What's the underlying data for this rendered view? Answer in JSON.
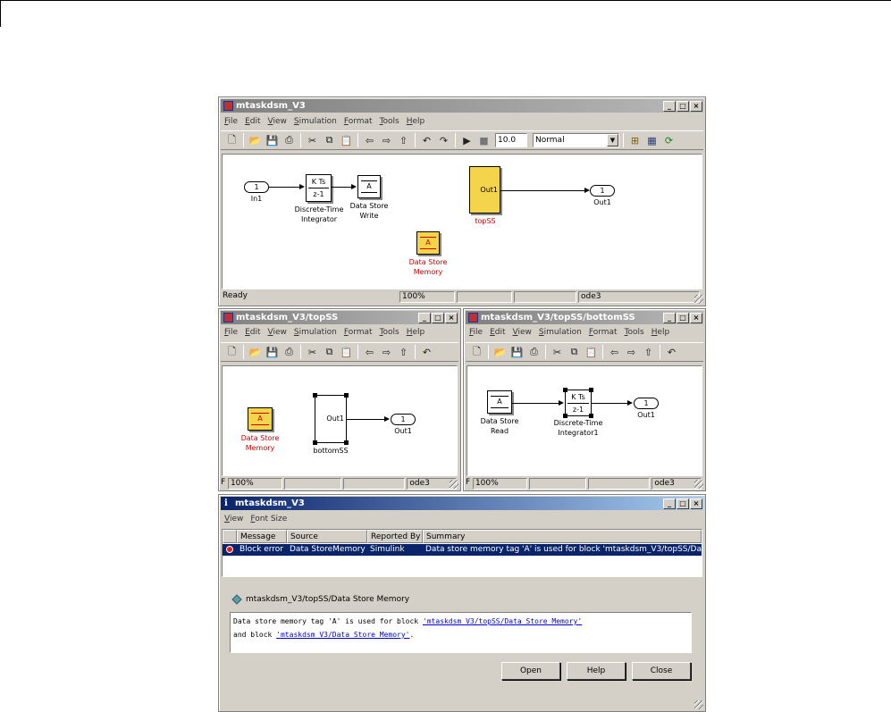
{
  "main_window": {
    "title": "mtaskdsm_V3",
    "menu": [
      "File",
      "Edit",
      "View",
      "Simulation",
      "Format",
      "Tools",
      "Help"
    ],
    "stop_time": "10.0",
    "sim_mode": "Normal",
    "blocks": {
      "in1_port": "1",
      "in1_label": "In1",
      "integrator_top": "K Ts",
      "integrator_bottom": "z-1",
      "integrator_label": "Discrete-Time\nIntegrator",
      "dsw_text": "A",
      "dsw_label": "Data Store\nWrite",
      "topss_port": "Out1",
      "topss_label": "topSS",
      "out1_port": "1",
      "out1_label": "Out1",
      "dsm_text": "A",
      "dsm_label": "Data Store\nMemory"
    },
    "status": {
      "state": "Ready",
      "zoom": "100%",
      "solver": "ode3"
    }
  },
  "topss_window": {
    "title": "mtaskdsm_V3/topSS",
    "menu": [
      "File",
      "Edit",
      "View",
      "Simulation",
      "Format",
      "Tools",
      "Help"
    ],
    "blocks": {
      "dsm_text": "A",
      "dsm_label": "Data Store\nMemory",
      "bottomss_port": "Out1",
      "bottomss_label": "bottomSS",
      "out1_port": "1",
      "out1_label": "Out1"
    },
    "status": {
      "state": "F",
      "zoom": "100%",
      "solver": "ode3"
    }
  },
  "bottomss_window": {
    "title": "mtaskdsm_V3/topSS/bottomSS",
    "menu": [
      "File",
      "Edit",
      "View",
      "Simulation",
      "Format",
      "Tools",
      "Help"
    ],
    "blocks": {
      "dsr_text": "A",
      "dsr_label": "Data Store\nRead",
      "integrator_top": "K Ts",
      "integrator_bottom": "z-1",
      "integrator_label": "Discrete-Time\nIntegrator1",
      "out1_port": "1",
      "out1_label": "Out1"
    },
    "status": {
      "state": "F",
      "zoom": "100%",
      "solver": "ode3"
    }
  },
  "diag_window": {
    "title": "mtaskdsm_V3",
    "menu": [
      "View",
      "Font Size"
    ],
    "columns": [
      "Message",
      "Source",
      "Reported By",
      "Summary"
    ],
    "row": {
      "message": "Block error",
      "source": "Data StoreMemory",
      "reported_by": "Simulink",
      "summary": "Data store memory tag 'A' is used for block 'mtaskdsm_V3/topSS/Dat..."
    },
    "path": "mtaskdsm_V3/topSS/Data Store Memory",
    "msg_line1_pre": "Data store memory tag 'A' is used for block ",
    "msg_link1": "'mtaskdsm_V3/topSS/Data Store Memory'",
    "msg_line2_pre": "and block ",
    "msg_link2": "'mtaskdsm_V3/Data Store Memory'",
    "msg_line2_post": ".",
    "buttons": {
      "open": "Open",
      "help": "Help",
      "close": "Close"
    }
  }
}
